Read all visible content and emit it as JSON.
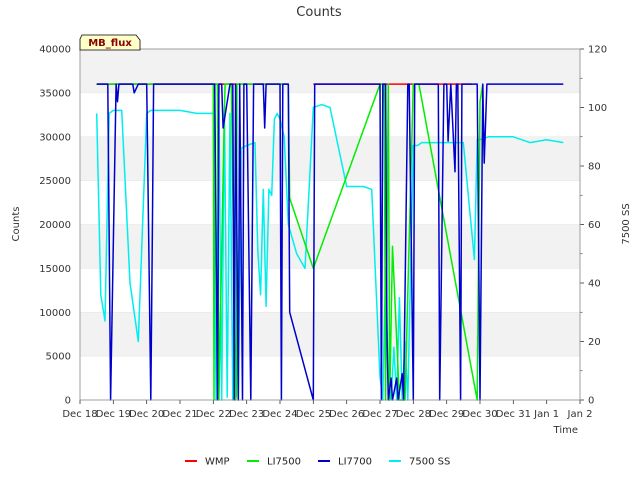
{
  "chart_data": {
    "type": "line",
    "title": "Counts",
    "xlabel": "Time",
    "ylabel": "Counts",
    "y2label": "7500 SS",
    "annotation": "MB_flux",
    "xlim": [
      "2022-12-18",
      "2023-01-02"
    ],
    "ylim": [
      0,
      40000
    ],
    "y2lim": [
      0,
      120
    ],
    "x_ticks": [
      "Dec 18",
      "Dec 19",
      "Dec 20",
      "Dec 21",
      "Dec 22",
      "Dec 23",
      "Dec 24",
      "Dec 25",
      "Dec 26",
      "Dec 27",
      "Dec 28",
      "Dec 29",
      "Dec 30",
      "Dec 31",
      "Jan 1",
      "Jan 2"
    ],
    "y_ticks": [
      "0",
      "5000",
      "10000",
      "15000",
      "20000",
      "25000",
      "30000",
      "35000",
      "40000"
    ],
    "y2_ticks": [
      "0",
      "20",
      "40",
      "60",
      "80",
      "100",
      "120"
    ],
    "grid": true,
    "legend_position": "bottom",
    "series": [
      {
        "name": "WMP",
        "color": "#ff0000",
        "axis": "left",
        "x": [
          "2022-12-18 12:00",
          "2022-12-24 06:00",
          "2022-12-24 06:01",
          "2022-12-25 00:00",
          "2022-12-29 18:00"
        ],
        "y": [
          36000,
          36000,
          null,
          36000,
          36000
        ]
      },
      {
        "name": "LI7500",
        "color": "#00ee00",
        "axis": "left",
        "x": [
          "2022-12-18 12:00",
          "2022-12-22 00:00",
          "2022-12-22 00:30",
          "2022-12-22 01:00",
          "2022-12-22 03:00",
          "2022-12-22 04:00",
          "2022-12-22 08:00",
          "2022-12-22 08:30",
          "2022-12-22 13:00",
          "2022-12-22 16:00",
          "2022-12-22 16:30",
          "2022-12-22 17:00",
          "2022-12-22 20:00",
          "2022-12-24 06:00",
          "2022-12-24 07:00",
          "2022-12-25 00:00",
          "2022-12-27 00:00",
          "2022-12-27 03:00",
          "2022-12-27 04:00",
          "2022-12-27 06:00",
          "2022-12-27 07:00",
          "2022-12-27 09:00",
          "2022-12-27 14:00",
          "2022-12-27 18:00",
          "2022-12-28 00:00",
          "2022-12-28 02:00",
          "2022-12-28 04:00",
          "2022-12-29 22:00",
          "2022-12-30 00:00",
          "2022-12-30 02:00"
        ],
        "y": [
          36000,
          36000,
          0,
          36000,
          36000,
          0,
          33000,
          36000,
          36000,
          0,
          500,
          36000,
          36000,
          36000,
          23000,
          15000,
          36000,
          36000,
          0,
          36000,
          0,
          17500,
          0,
          0,
          36000,
          36000,
          36000,
          0,
          34000,
          36000
        ]
      },
      {
        "name": "LI7700",
        "color": "#0000cc",
        "axis": "left",
        "x": [
          "2022-12-18 12:00",
          "2022-12-18 20:00",
          "2022-12-18 22:00",
          "2022-12-19 02:00",
          "2022-12-19 03:00",
          "2022-12-19 04:00",
          "2022-12-19 14:00",
          "2022-12-19 15:00",
          "2022-12-19 18:00",
          "2022-12-19 20:00",
          "2022-12-20 00:00",
          "2022-12-20 03:00",
          "2022-12-20 04:00",
          "2022-12-20 05:00",
          "2022-12-22 00:00",
          "2022-12-22 01:00",
          "2022-12-22 03:00",
          "2022-12-22 04:00",
          "2022-12-22 06:00",
          "2022-12-22 07:00",
          "2022-12-22 12:00",
          "2022-12-22 14:00",
          "2022-12-22 15:00",
          "2022-12-22 16:00",
          "2022-12-22 18:00",
          "2022-12-22 19:00",
          "2022-12-22 21:00",
          "2022-12-22 22:00",
          "2022-12-23 00:00",
          "2022-12-23 03:00",
          "2022-12-23 05:00",
          "2022-12-23 12:00",
          "2022-12-23 13:00",
          "2022-12-23 14:00",
          "2022-12-24 00:00",
          "2022-12-24 01:00",
          "2022-12-24 02:00",
          "2022-12-24 06:00",
          "2022-12-24 07:00",
          "2022-12-25 00:00",
          "2022-12-25 01:00",
          "2022-12-25 04:00",
          "2022-12-26 00:00",
          "2022-12-26 02:00",
          "2022-12-26 18:00",
          "2022-12-26 20:00",
          "2022-12-27 00:00",
          "2022-12-27 01:00",
          "2022-12-27 02:00",
          "2022-12-27 04:00",
          "2022-12-27 05:00",
          "2022-12-27 06:00",
          "2022-12-27 08:00",
          "2022-12-27 09:00",
          "2022-12-27 12:00",
          "2022-12-27 13:00",
          "2022-12-27 16:00",
          "2022-12-27 17:00",
          "2022-12-27 20:00",
          "2022-12-27 21:00",
          "2022-12-28 00:00",
          "2022-12-28 01:00",
          "2022-12-28 18:00",
          "2022-12-28 19:00",
          "2022-12-28 22:00",
          "2022-12-29 00:00",
          "2022-12-29 01:00",
          "2022-12-29 03:00",
          "2022-12-29 06:00",
          "2022-12-29 07:00",
          "2022-12-29 08:00",
          "2022-12-29 10:00",
          "2022-12-29 11:00",
          "2022-12-29 22:00",
          "2022-12-30 00:00",
          "2022-12-30 02:00",
          "2022-12-30 03:00",
          "2022-12-30 05:00",
          "2022-12-30 06:00",
          "2022-12-30 08:00",
          "2022-12-31 00:00",
          "2023-01-01 12:00"
        ],
        "y": [
          36000,
          36000,
          0,
          36000,
          34000,
          36000,
          36000,
          35000,
          36000,
          36000,
          36000,
          0,
          17000,
          36000,
          36000,
          36000,
          0,
          36000,
          36000,
          31000,
          36000,
          36000,
          0,
          36000,
          0,
          36000,
          0,
          36000,
          36000,
          0,
          36000,
          36000,
          31000,
          36000,
          36000,
          0,
          36000,
          36000,
          10000,
          0,
          36000,
          36000,
          36000,
          36000,
          36000,
          36000,
          36000,
          0,
          36000,
          36000,
          8000,
          0,
          2500,
          0,
          2500,
          0,
          3000,
          0,
          36000,
          36000,
          0,
          36000,
          36000,
          0,
          36000,
          36000,
          29500,
          36000,
          26000,
          36000,
          36000,
          0,
          36000,
          36000,
          0,
          36000,
          27000,
          36000,
          36000,
          36000,
          36000,
          36000
        ]
      },
      {
        "name": "7500 SS",
        "color": "#00eeee",
        "axis": "right",
        "x": [
          "2022-12-18 12:00",
          "2022-12-18 15:00",
          "2022-12-18 18:00",
          "2022-12-18 21:00",
          "2022-12-19 00:00",
          "2022-12-19 06:00",
          "2022-12-19 12:00",
          "2022-12-19 18:00",
          "2022-12-20 00:00",
          "2022-12-20 03:00",
          "2022-12-20 06:00",
          "2022-12-20 12:00",
          "2022-12-21 00:00",
          "2022-12-21 12:00",
          "2022-12-22 00:00",
          "2022-12-22 02:00",
          "2022-12-22 04:00",
          "2022-12-22 06:00",
          "2022-12-22 08:00",
          "2022-12-22 10:00",
          "2022-12-22 12:00",
          "2022-12-22 14:00",
          "2022-12-22 16:00",
          "2022-12-22 18:00",
          "2022-12-22 20:00",
          "2022-12-23 00:00",
          "2022-12-23 06:00",
          "2022-12-23 08:00",
          "2022-12-23 10:00",
          "2022-12-23 12:00",
          "2022-12-23 14:00",
          "2022-12-23 16:00",
          "2022-12-23 18:00",
          "2022-12-23 20:00",
          "2022-12-23 22:00",
          "2022-12-24 00:00",
          "2022-12-24 03:00",
          "2022-12-24 06:00",
          "2022-12-24 09:00",
          "2022-12-24 12:00",
          "2022-12-24 18:00",
          "2022-12-25 00:00",
          "2022-12-25 06:00",
          "2022-12-25 12:00",
          "2022-12-26 00:00",
          "2022-12-26 06:00",
          "2022-12-26 12:00",
          "2022-12-26 18:00",
          "2022-12-27 00:00",
          "2022-12-27 02:00",
          "2022-12-27 04:00",
          "2022-12-27 06:00",
          "2022-12-27 08:00",
          "2022-12-27 10:00",
          "2022-12-27 12:00",
          "2022-12-27 14:00",
          "2022-12-27 16:00",
          "2022-12-27 18:00",
          "2022-12-27 20:00",
          "2022-12-28 00:00",
          "2022-12-28 03:00",
          "2022-12-28 06:00",
          "2022-12-28 12:00",
          "2022-12-29 00:00",
          "2022-12-29 12:00",
          "2022-12-29 20:00",
          "2022-12-29 22:00",
          "2022-12-30 00:00",
          "2022-12-30 06:00",
          "2022-12-30 12:00",
          "2022-12-31 00:00",
          "2022-12-31 12:00",
          "2023-01-01 00:00",
          "2023-01-01 12:00"
        ],
        "y": [
          98,
          36,
          27,
          98,
          99,
          99,
          40,
          20,
          98,
          99,
          99,
          99,
          99,
          98,
          98,
          0,
          99,
          0,
          99,
          1,
          98,
          0,
          86,
          0,
          86,
          87,
          88,
          51,
          36,
          72,
          32,
          72,
          70,
          96,
          98,
          96,
          90,
          60,
          55,
          50,
          45,
          100,
          101,
          100,
          73,
          73,
          73,
          72,
          8,
          0,
          45,
          7,
          0,
          18,
          0,
          35,
          0,
          20,
          0,
          87,
          87,
          88,
          88,
          88,
          88,
          48,
          89,
          89,
          90,
          90,
          90,
          88,
          89,
          88
        ]
      }
    ]
  }
}
